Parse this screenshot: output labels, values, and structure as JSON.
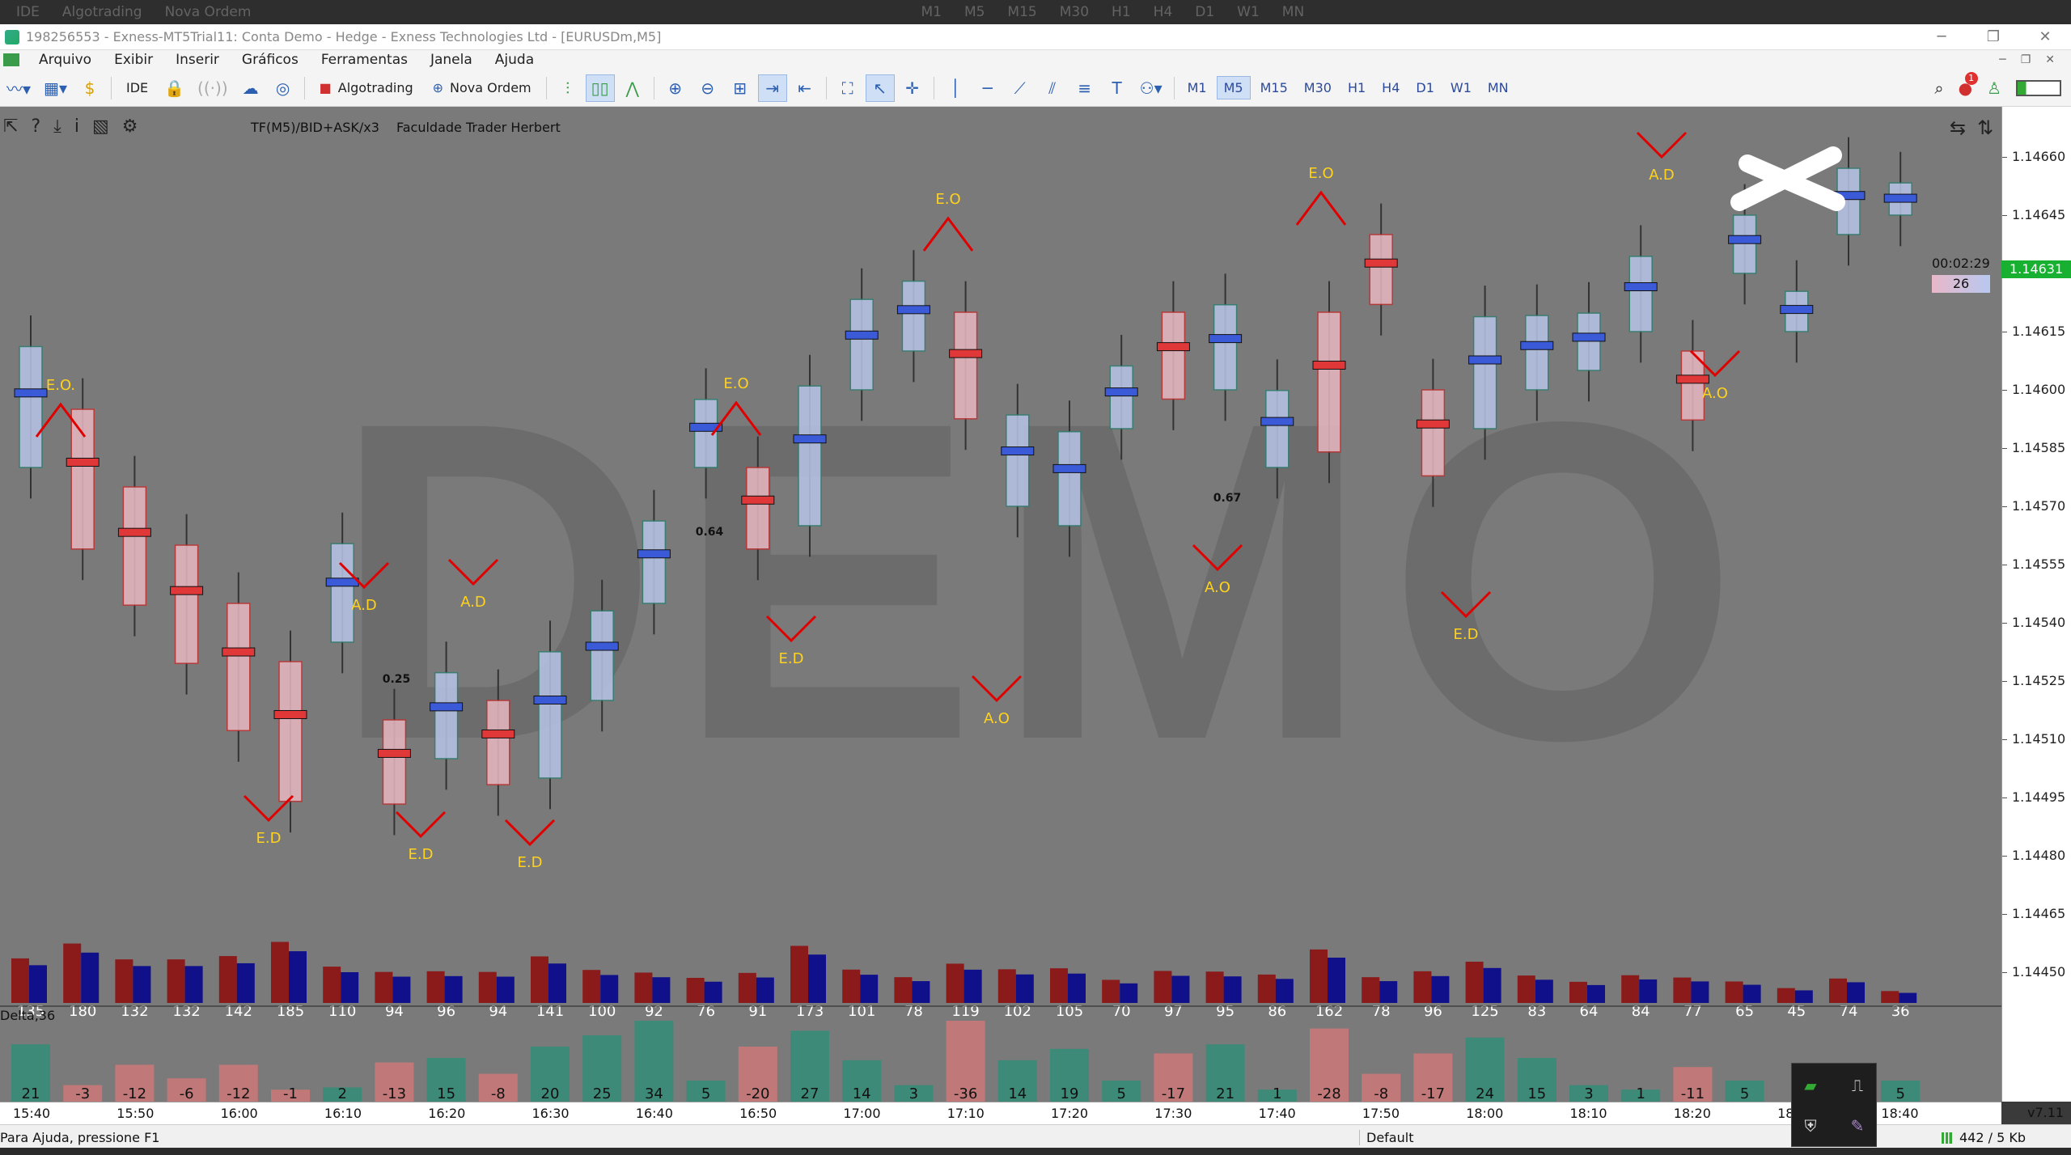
{
  "ghost_toolbar": {
    "left_items": [
      "IDE",
      "Algotrading",
      "Nova Ordem"
    ],
    "timeframes": [
      "M1",
      "M5",
      "M15",
      "M30",
      "H1",
      "H4",
      "D1",
      "W1",
      "MN"
    ]
  },
  "window": {
    "title": "198256553 - Exness-MT5Trial11: Conta Demo - Hedge - Exness Technologies Ltd - [EURUSDm,M5]"
  },
  "menu": [
    "Arquivo",
    "Exibir",
    "Inserir",
    "Gráficos",
    "Ferramentas",
    "Janela",
    "Ajuda"
  ],
  "toolbar": {
    "ide_label": "IDE",
    "algotrading_label": "Algotrading",
    "new_order_label": "Nova Ordem",
    "timeframes": [
      "M1",
      "M5",
      "M15",
      "M30",
      "H1",
      "H4",
      "D1",
      "W1",
      "MN"
    ],
    "active_timeframe": "M5",
    "notification_count": "1"
  },
  "chart": {
    "indicator_text": "TF(M5)/BID+ASK/x3",
    "indicator_author": "Faculdade Trader Herbert",
    "watermark": "DEMO",
    "countdown": "00:02:29",
    "tick_count": "26",
    "current_price": "1.14631",
    "price_ticks": [
      "1.14660",
      "1.14645",
      "1.14615",
      "1.14600",
      "1.14585",
      "1.14570",
      "1.14555",
      "1.14540",
      "1.14525",
      "1.14510",
      "1.14495",
      "1.14480",
      "1.14465",
      "1.14450"
    ],
    "time_labels": [
      "15:40",
      "15:50",
      "16:00",
      "16:10",
      "16:20",
      "16:30",
      "16:40",
      "16:50",
      "17:00",
      "17:10",
      "17:20",
      "17:30",
      "17:40",
      "17:50",
      "18:00",
      "18:10",
      "18:20",
      "18",
      "18:40"
    ],
    "volume": [
      "135",
      "180",
      "132",
      "132",
      "142",
      "185",
      "110",
      "94",
      "96",
      "94",
      "141",
      "100",
      "92",
      "76",
      "91",
      "173",
      "101",
      "78",
      "119",
      "102",
      "105",
      "70",
      "97",
      "95",
      "86",
      "162",
      "78",
      "96",
      "125",
      "83",
      "64",
      "84",
      "77",
      "65",
      "45",
      "74",
      "36"
    ],
    "delta_label": "Delta,36",
    "delta": [
      "21",
      "-3",
      "-12",
      "-6",
      "-12",
      "-1",
      "2",
      "-13",
      "15",
      "-8",
      "20",
      "25",
      "34",
      "5",
      "-20",
      "27",
      "14",
      "3",
      "-36",
      "14",
      "19",
      "5",
      "-17",
      "21",
      "1",
      "-28",
      "-8",
      "-17",
      "24",
      "15",
      "3",
      "1",
      "-11",
      "5",
      "",
      "",
      "5"
    ],
    "annotations": [
      "E.O.",
      "A.D",
      "A.D",
      "E.D",
      "E.D",
      "E.D",
      "E.O",
      "E.D",
      "E.O",
      "A.O",
      "A.O",
      "E.O",
      "E.D",
      "A.D",
      "A.O"
    ],
    "ratios": [
      "0.25",
      "0.64",
      "0.67"
    ],
    "version": "v7.11"
  },
  "status": {
    "help": "Para Ajuda, pressione F1",
    "profile": "Default",
    "traffic": "442 / 5 Kb"
  },
  "colors": {
    "chart_bg": "#7a7a7a",
    "bear": "#8b1a1a",
    "bull": "#10108a",
    "delta_pos": "#3d8a78",
    "delta_neg": "#c07878",
    "annotation": "#ffd21e",
    "arrow": "#e00000",
    "price_up": "#18b030"
  }
}
